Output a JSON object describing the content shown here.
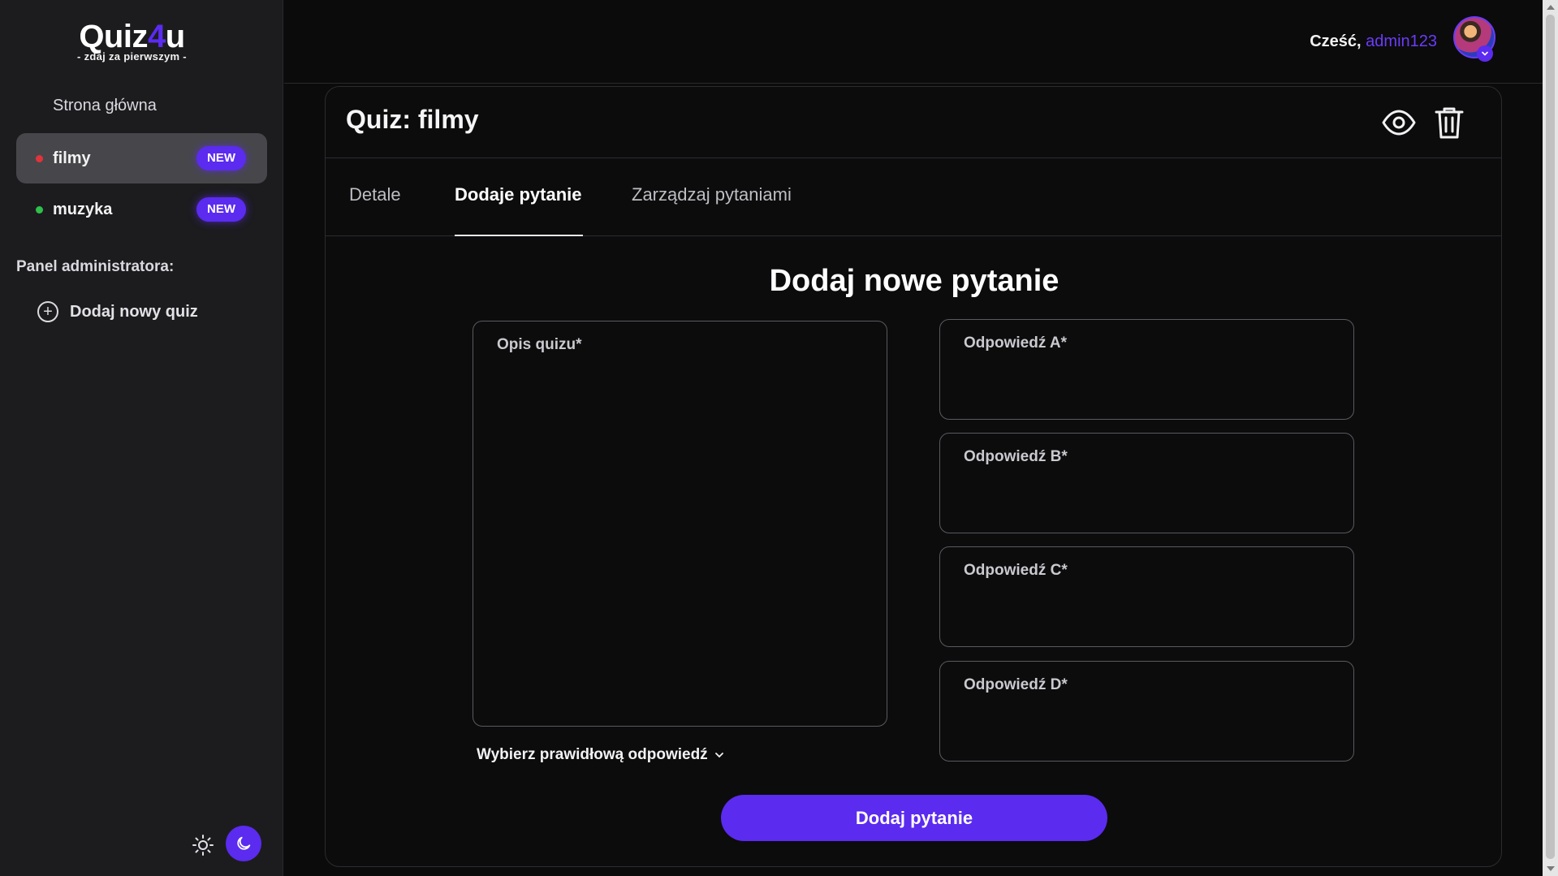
{
  "brand": {
    "name_part1": "Quiz",
    "name_accent": "4",
    "name_part2": "u",
    "tagline": "- zdaj za pierwszym -"
  },
  "sidebar": {
    "home_label": "Strona główna",
    "quizzes": [
      {
        "label": "filmy",
        "badge": "NEW",
        "dot_color": "#e0333a",
        "active": true
      },
      {
        "label": "muzyka",
        "badge": "NEW",
        "dot_color": "#2fbf4a",
        "active": false
      }
    ],
    "admin_title": "Panel administratora:",
    "add_quiz_label": "Dodaj nowy quiz"
  },
  "header": {
    "greeting": "Cześć,",
    "username": "admin123"
  },
  "card": {
    "title": "Quiz: filmy",
    "tabs": [
      {
        "label": "Detale",
        "active": false
      },
      {
        "label": "Dodaje pytanie",
        "active": true
      },
      {
        "label": "Zarządzaj pytaniami",
        "active": false
      }
    ]
  },
  "form": {
    "title": "Dodaj nowe pytanie",
    "description_placeholder": "Opis quizu*",
    "answers": [
      {
        "placeholder": "Odpowiedź A*"
      },
      {
        "placeholder": "Odpowiedź B*"
      },
      {
        "placeholder": "Odpowiedź C*"
      },
      {
        "placeholder": "Odpowiedź D*"
      }
    ],
    "select_label": "Wybierz prawidłową odpowiedź",
    "submit_label": "Dodaj pytanie"
  },
  "colors": {
    "accent": "#5b2bf0",
    "background": "#0b0b0c",
    "sidebar": "#1c1c1f",
    "active_item": "#47474b"
  },
  "icons": [
    "plus-circle-icon",
    "sun-icon",
    "moon-icon",
    "eye-icon",
    "trash-icon",
    "chevron-down-icon",
    "avatar"
  ]
}
